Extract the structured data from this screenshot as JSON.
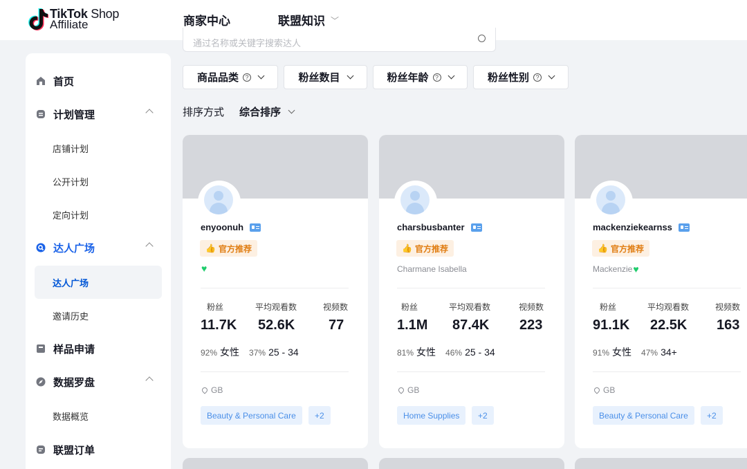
{
  "header": {
    "logo_line1": "TikTok",
    "logo_shop": "Shop",
    "logo_line2": "Affiliate",
    "nav": [
      "商家中心",
      "联盟知识"
    ]
  },
  "sidebar": {
    "items": [
      {
        "label": "首页"
      },
      {
        "label": "计划管理"
      },
      {
        "label": "店铺计划"
      },
      {
        "label": "公开计划"
      },
      {
        "label": "定向计划"
      },
      {
        "label": "达人广场"
      },
      {
        "label": "达人广场"
      },
      {
        "label": "邀请历史"
      },
      {
        "label": "样品申请"
      },
      {
        "label": "数据罗盘"
      },
      {
        "label": "数据概览"
      },
      {
        "label": "联盟订单"
      }
    ]
  },
  "search": {
    "placeholder": "通过名称或关键字搜索达人"
  },
  "filters": [
    "商品品类",
    "粉丝数目",
    "粉丝年龄",
    "粉丝性别"
  ],
  "sort": {
    "label": "排序方式",
    "value": "综合排序"
  },
  "stat_labels": {
    "followers": "粉丝",
    "avg_views": "平均观看数",
    "videos": "视频数"
  },
  "recommend_label": "官方推荐",
  "gender_label": "女性",
  "colors": {
    "accent": "#1a62e8",
    "recommend": "#e07d12",
    "tag": "#4a8fe8",
    "verified": "#1fcc6c"
  },
  "creators": [
    {
      "username": "enyoonuh",
      "nickname": "",
      "followers": "11.7K",
      "avg_views": "52.6K",
      "videos": "77",
      "female_pct": "92%",
      "age_pct": "37%",
      "age": "25 - 34",
      "region": "GB",
      "category": "Beauty & Personal Care",
      "more": "+2"
    },
    {
      "username": "charsbusbanter",
      "nickname": "Charmane Isabella",
      "followers": "1.1M",
      "avg_views": "87.4K",
      "videos": "223",
      "female_pct": "81%",
      "age_pct": "46%",
      "age": "25 - 34",
      "region": "GB",
      "category": "Home Supplies",
      "more": "+2"
    },
    {
      "username": "mackenziekearnss",
      "nickname": "Mackenzie",
      "followers": "91.1K",
      "avg_views": "22.5K",
      "videos": "163",
      "female_pct": "91%",
      "age_pct": "47%",
      "age": "34+",
      "region": "GB",
      "category": "Beauty & Personal Care",
      "more": "+2"
    }
  ]
}
